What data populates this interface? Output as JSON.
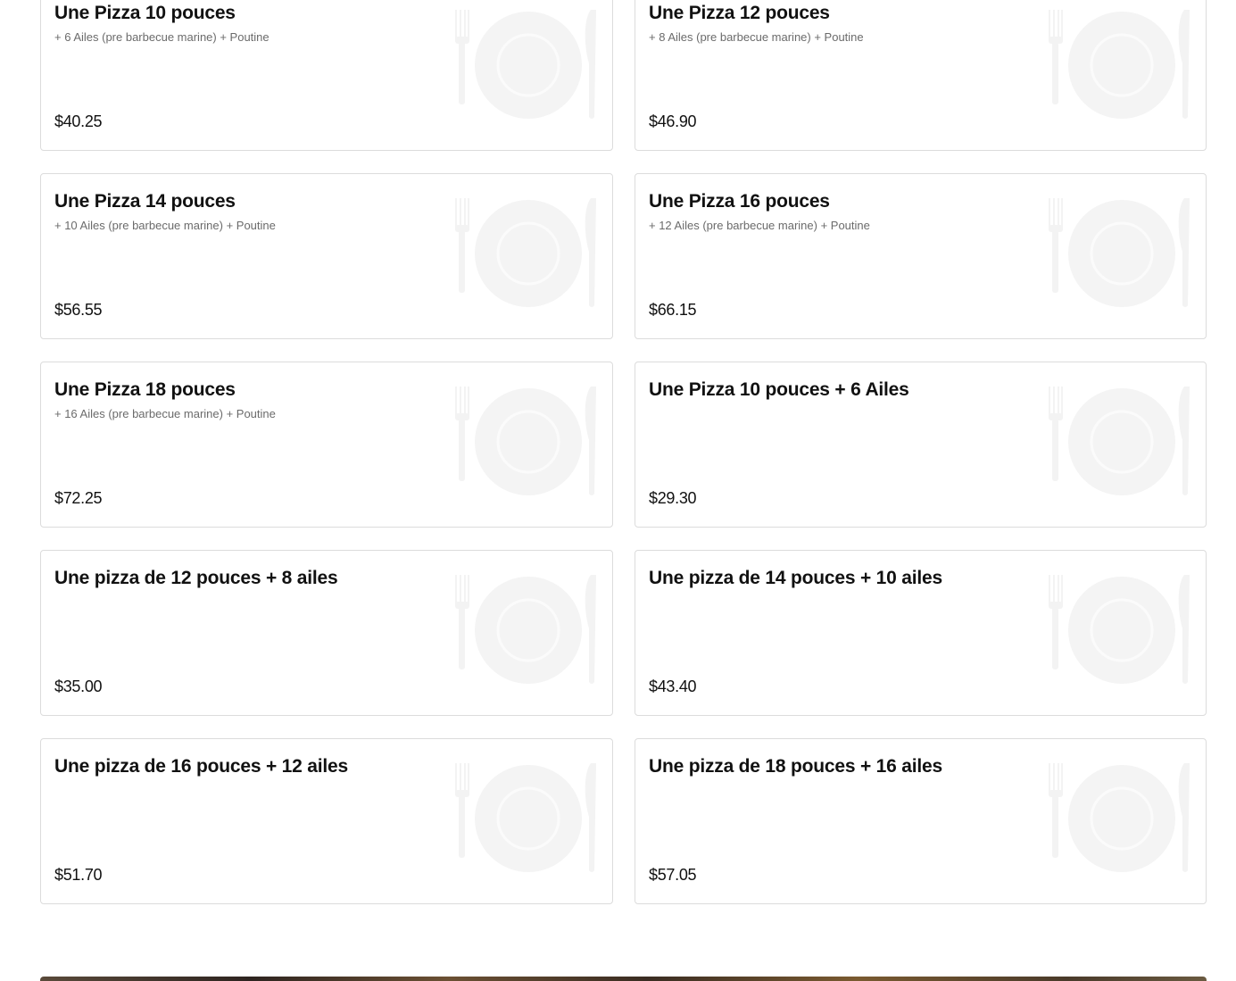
{
  "menu_items": [
    {
      "title": "Une Pizza 10 pouces",
      "description": "+ 6 Ailes (pre barbecue marine) + Poutine",
      "price": "$40.25",
      "image_icon": "plate-cutlery-icon"
    },
    {
      "title": "Une Pizza 12 pouces",
      "description": "+ 8 Ailes (pre barbecue marine) + Poutine",
      "price": "$46.90",
      "image_icon": "plate-cutlery-icon"
    },
    {
      "title": "Une Pizza 14 pouces",
      "description": "+ 10 Ailes (pre barbecue marine) + Poutine",
      "price": "$56.55",
      "image_icon": "plate-cutlery-icon"
    },
    {
      "title": "Une Pizza 16 pouces",
      "description": "+ 12 Ailes (pre barbecue marine) + Poutine",
      "price": "$66.15",
      "image_icon": "plate-cutlery-icon"
    },
    {
      "title": "Une Pizza 18 pouces",
      "description": "+ 16 Ailes (pre barbecue marine) + Poutine",
      "price": "$72.25",
      "image_icon": "plate-cutlery-icon"
    },
    {
      "title": "Une Pizza 10 pouces + 6 Ailes",
      "description": "",
      "price": "$29.30",
      "image_icon": "plate-cutlery-icon"
    },
    {
      "title": "Une pizza de 12 pouces + 8 ailes",
      "description": "",
      "price": "$35.00",
      "image_icon": "plate-cutlery-icon"
    },
    {
      "title": "Une pizza de 14 pouces + 10 ailes",
      "description": "",
      "price": "$43.40",
      "image_icon": "plate-cutlery-icon"
    },
    {
      "title": "Une pizza de 16 pouces + 12 ailes",
      "description": "",
      "price": "$51.70",
      "image_icon": "plate-cutlery-icon"
    },
    {
      "title": "Une pizza de 18 pouces + 16 ailes",
      "description": "",
      "price": "$57.05",
      "image_icon": "plate-cutlery-icon"
    }
  ],
  "colors": {
    "card_border": "#dcdcdc",
    "title": "#111111",
    "description": "#6b6b6b",
    "placeholder_icon": "#f3f3f3"
  }
}
